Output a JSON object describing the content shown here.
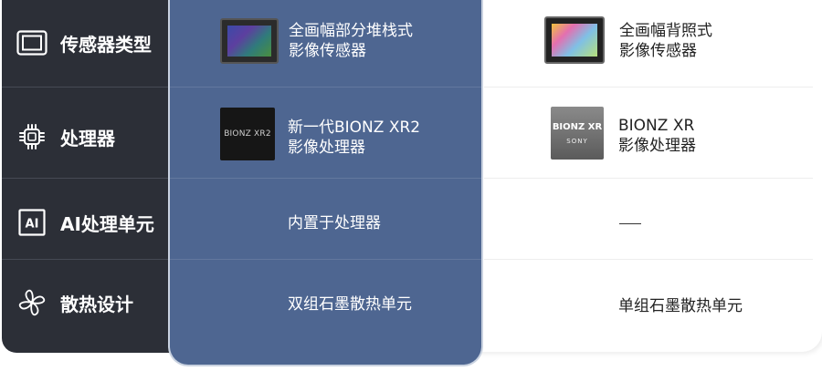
{
  "features": [
    {
      "icon": "sensor-icon",
      "label": "传感器类型"
    },
    {
      "icon": "processor-chip-icon",
      "label": "处理器"
    },
    {
      "icon": "ai-icon",
      "label": "AI处理单元"
    },
    {
      "icon": "fan-icon",
      "label": "散热设计"
    }
  ],
  "mid": {
    "sensor": {
      "line1": "全画幅部分堆栈式",
      "line2": "影像传感器"
    },
    "processor": {
      "chip_label": "BIONZ XR2",
      "line1": "新一代BIONZ XR2",
      "line2": "影像处理器"
    },
    "ai": {
      "text": "内置于处理器"
    },
    "cooling": {
      "text": "双组石墨散热单元"
    }
  },
  "right": {
    "sensor": {
      "line1": "全画幅背照式",
      "line2": "影像传感器"
    },
    "processor": {
      "chip_label": "BIONZ XR",
      "chip_brand": "SONY",
      "line1": "BIONZ XR",
      "line2": "影像处理器"
    },
    "ai": {
      "text": "—"
    },
    "cooling": {
      "text": "单组石墨散热单元"
    }
  },
  "colors": {
    "left_panel": "#2c2f37",
    "mid_panel": "#4e6691",
    "right_panel": "#ffffff"
  }
}
